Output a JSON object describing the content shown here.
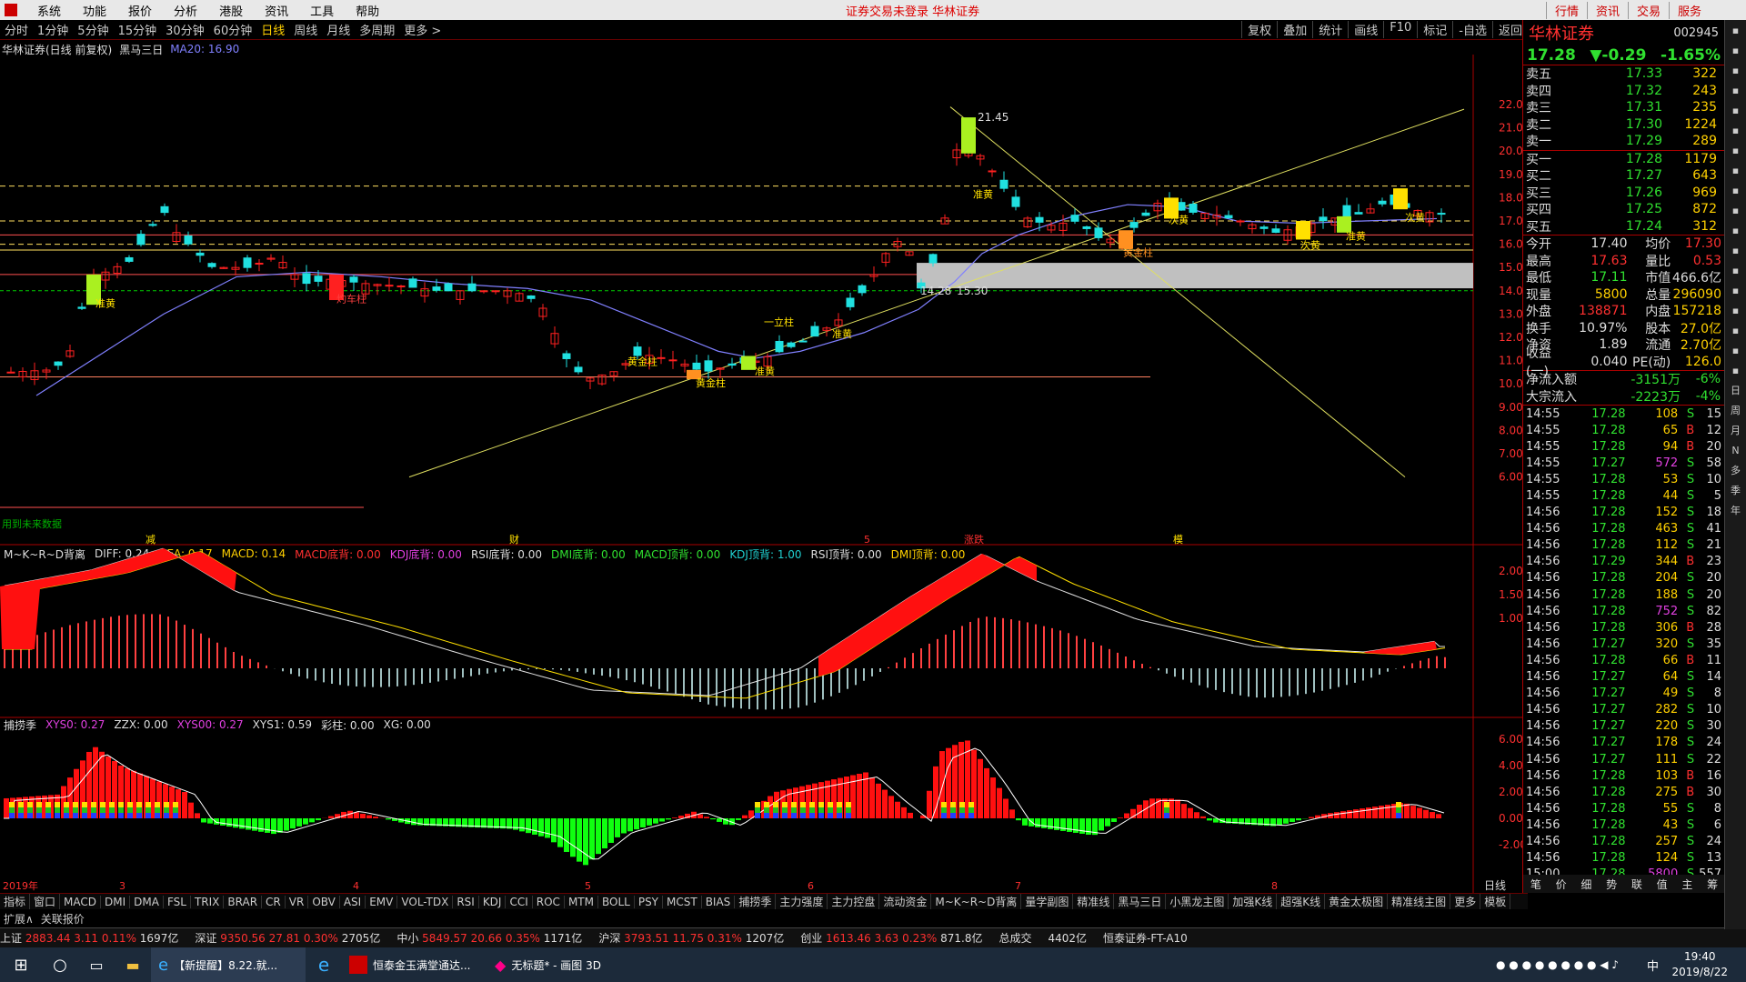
{
  "menubar": {
    "items": [
      "系统",
      "功能",
      "报价",
      "分析",
      "港股",
      "资讯",
      "工具",
      "帮助"
    ],
    "center": "证券交易未登录  华林证券",
    "right": [
      "行情",
      "资讯",
      "交易",
      "服务"
    ]
  },
  "periods": {
    "items": [
      "分时",
      "1分钟",
      "5分钟",
      "15分钟",
      "30分钟",
      "60分钟",
      "日线",
      "周线",
      "月线",
      "多周期",
      "更多 >"
    ],
    "active": "日线",
    "right": [
      "复权",
      "叠加",
      "统计",
      "画线",
      "F10",
      "标记",
      "-自选",
      "返回"
    ]
  },
  "chartinfo": {
    "title": "华林证券(日线 前复权)",
    "indicator": "黑马三日",
    "ma": "MA20: 16.90"
  },
  "main": {
    "yaxis": [
      "22.00",
      "21.00",
      "20.00",
      "19.00",
      "18.00",
      "17.00",
      "16.00",
      "15.00",
      "14.00",
      "13.00",
      "12.00",
      "11.00",
      "10.00",
      "9.00",
      "8.00",
      "7.00",
      "6.00"
    ],
    "high_label": "21.45",
    "mid_label": "14.28",
    "mid_label2": "15.30",
    "ann": [
      "准黄",
      "灼车柱",
      "黄金柱",
      "黄金柱",
      "准黄",
      "一立柱",
      "准黄",
      "准黄",
      "次黄",
      "黄金柱",
      "次黄",
      "准黄",
      "次黄"
    ],
    "notice": "用到未来数据",
    "markers": [
      "减",
      "财",
      "5",
      "涨跌",
      "模"
    ]
  },
  "ind1": {
    "name": "M~K~R~D背离",
    "vals": [
      [
        "DIFF: 0.24",
        "w"
      ],
      [
        "DEA: 0.17",
        "y"
      ],
      [
        "MACD: 0.14",
        "y"
      ],
      [
        "MACD底背: 0.00",
        "r"
      ],
      [
        "KDJ底背: 0.00",
        "m"
      ],
      [
        "RSI底背: 0.00",
        "w"
      ],
      [
        "DMI底背: 0.00",
        "g"
      ],
      [
        "MACD顶背: 0.00",
        "g"
      ],
      [
        "KDJ顶背: 1.00",
        "c"
      ],
      [
        "RSI顶背: 0.00",
        "w"
      ],
      [
        "DMI顶背: 0.00",
        "y"
      ]
    ],
    "yaxis": [
      "2.00",
      "1.50",
      "1.00"
    ]
  },
  "ind2": {
    "name": "捕捞季",
    "vals": [
      [
        "XYS0: 0.27",
        "m"
      ],
      [
        "ZZX: 0.00",
        "w"
      ],
      [
        "XYS00: 0.27",
        "m"
      ],
      [
        "XYS1: 0.59",
        "w"
      ],
      [
        "彩柱: 0.00",
        "w"
      ],
      [
        "XG: 0.00",
        "w"
      ]
    ],
    "yaxis": [
      "6.00",
      "4.00",
      "2.00",
      "0.00",
      "-2.00"
    ]
  },
  "dates": [
    "2019年",
    "3",
    "4",
    "5",
    "6",
    "7",
    "8"
  ],
  "xlabel": "日线",
  "tabs": [
    "指标",
    "窗口",
    "MACD",
    "DMI",
    "DMA",
    "FSL",
    "TRIX",
    "BRAR",
    "CR",
    "VR",
    "OBV",
    "ASI",
    "EMV",
    "VOL-TDX",
    "RSI",
    "KDJ",
    "CCI",
    "ROC",
    "MTM",
    "BOLL",
    "PSY",
    "MCST",
    "BIAS",
    "捕捞季",
    "主力强度",
    "主力控盘",
    "流动资金",
    "M~K~R~D背离",
    "量学副图",
    "精准线",
    "黑马三日",
    "小黑龙主图",
    "加强K线",
    "超强K线",
    "黄金太极图",
    "精准线主图",
    "更多",
    "模板"
  ],
  "ext": [
    "扩展∧",
    "关联报价"
  ],
  "index": [
    {
      "n": "上证",
      "v": "2883.44",
      "c": "3.11",
      "p": "0.11%",
      "a": "1697亿"
    },
    {
      "n": "深证",
      "v": "9350.56",
      "c": "27.81",
      "p": "0.30%",
      "a": "2705亿"
    },
    {
      "n": "中小",
      "v": "5849.57",
      "c": "20.66",
      "p": "0.35%",
      "a": "1171亿"
    },
    {
      "n": "沪深",
      "v": "3793.51",
      "c": "11.75",
      "p": "0.31%",
      "a": "1207亿"
    },
    {
      "n": "创业",
      "v": "1613.46",
      "c": "3.63",
      "p": "0.23%",
      "a": "871.8亿"
    }
  ],
  "index_extra": [
    "总成交",
    "4402亿",
    "恒泰证券-FT-A10"
  ],
  "stock": {
    "name": "华林证券",
    "code": "002945",
    "price": "17.28",
    "change": "▼-0.29",
    "pct": "-1.65%"
  },
  "sell": [
    [
      "卖五",
      "17.33",
      "322"
    ],
    [
      "卖四",
      "17.32",
      "243"
    ],
    [
      "卖三",
      "17.31",
      "235"
    ],
    [
      "卖二",
      "17.30",
      "1224"
    ],
    [
      "卖一",
      "17.29",
      "289"
    ]
  ],
  "buy": [
    [
      "买一",
      "17.28",
      "1179"
    ],
    [
      "买二",
      "17.27",
      "643"
    ],
    [
      "买三",
      "17.26",
      "969"
    ],
    [
      "买四",
      "17.25",
      "872"
    ],
    [
      "买五",
      "17.24",
      "312"
    ]
  ],
  "stats": [
    [
      "今开",
      "17.40",
      "均价",
      "17.30"
    ],
    [
      "最高",
      "17.63",
      "量比",
      "0.53"
    ],
    [
      "最低",
      "17.11",
      "市值",
      "466.6亿"
    ],
    [
      "现量",
      "5800",
      "总量",
      "296090"
    ],
    [
      "外盘",
      "138871",
      "内盘",
      "157218"
    ],
    [
      "换手",
      "10.97%",
      "股本",
      "27.0亿"
    ],
    [
      "净资",
      "1.89",
      "流通",
      "2.70亿"
    ],
    [
      "收益(一)",
      "0.040",
      "PE(动)",
      "126.0"
    ]
  ],
  "flows": [
    [
      "净流入额",
      "-3151万",
      "-6%"
    ],
    [
      "大宗流入",
      "-2223万",
      "-4%"
    ]
  ],
  "ticks": [
    [
      "14:55",
      "17.28",
      "108",
      "S",
      "15"
    ],
    [
      "14:55",
      "17.28",
      "65",
      "B",
      "12"
    ],
    [
      "14:55",
      "17.28",
      "94",
      "B",
      "20"
    ],
    [
      "14:55",
      "17.27",
      "572",
      "S",
      "58"
    ],
    [
      "14:55",
      "17.28",
      "53",
      "S",
      "10"
    ],
    [
      "14:55",
      "17.28",
      "44",
      "S",
      "5"
    ],
    [
      "14:56",
      "17.28",
      "152",
      "S",
      "18"
    ],
    [
      "14:56",
      "17.28",
      "463",
      "S",
      "41"
    ],
    [
      "14:56",
      "17.28",
      "112",
      "S",
      "21"
    ],
    [
      "14:56",
      "17.29",
      "344",
      "B",
      "23"
    ],
    [
      "14:56",
      "17.28",
      "204",
      "S",
      "20"
    ],
    [
      "14:56",
      "17.28",
      "188",
      "S",
      "20"
    ],
    [
      "14:56",
      "17.28",
      "752",
      "S",
      "82"
    ],
    [
      "14:56",
      "17.28",
      "306",
      "B",
      "28"
    ],
    [
      "14:56",
      "17.27",
      "320",
      "S",
      "35"
    ],
    [
      "14:56",
      "17.28",
      "66",
      "B",
      "11"
    ],
    [
      "14:56",
      "17.27",
      "64",
      "S",
      "14"
    ],
    [
      "14:56",
      "17.27",
      "49",
      "S",
      "8"
    ],
    [
      "14:56",
      "17.27",
      "282",
      "S",
      "10"
    ],
    [
      "14:56",
      "17.27",
      "220",
      "S",
      "30"
    ],
    [
      "14:56",
      "17.27",
      "178",
      "S",
      "24"
    ],
    [
      "14:56",
      "17.27",
      "111",
      "S",
      "22"
    ],
    [
      "14:56",
      "17.28",
      "103",
      "B",
      "16"
    ],
    [
      "14:56",
      "17.28",
      "275",
      "B",
      "30"
    ],
    [
      "14:56",
      "17.28",
      "55",
      "S",
      "8"
    ],
    [
      "14:56",
      "17.28",
      "43",
      "S",
      "6"
    ],
    [
      "14:56",
      "17.28",
      "257",
      "S",
      "24"
    ],
    [
      "14:56",
      "17.28",
      "124",
      "S",
      "13"
    ],
    [
      "15:00",
      "17.28",
      "5800",
      "S",
      "557"
    ]
  ],
  "rp_tabs": [
    "笔",
    "价",
    "细",
    "势",
    "联",
    "值",
    "主",
    "筹"
  ],
  "side": [
    "日",
    "周",
    "月",
    "N",
    "多",
    "季",
    "年"
  ],
  "taskbar": {
    "items": [
      "【新提醒】8.22.就...",
      "恒泰金玉满堂通达...",
      "无标题* - 画图 3D"
    ],
    "time": "19:40",
    "date": "2019/8/22",
    "lang": "中"
  },
  "colors": {
    "up": "#ff2020",
    "down": "#20e0e0",
    "yellow": "#ffe000",
    "green": "#20ff20"
  }
}
